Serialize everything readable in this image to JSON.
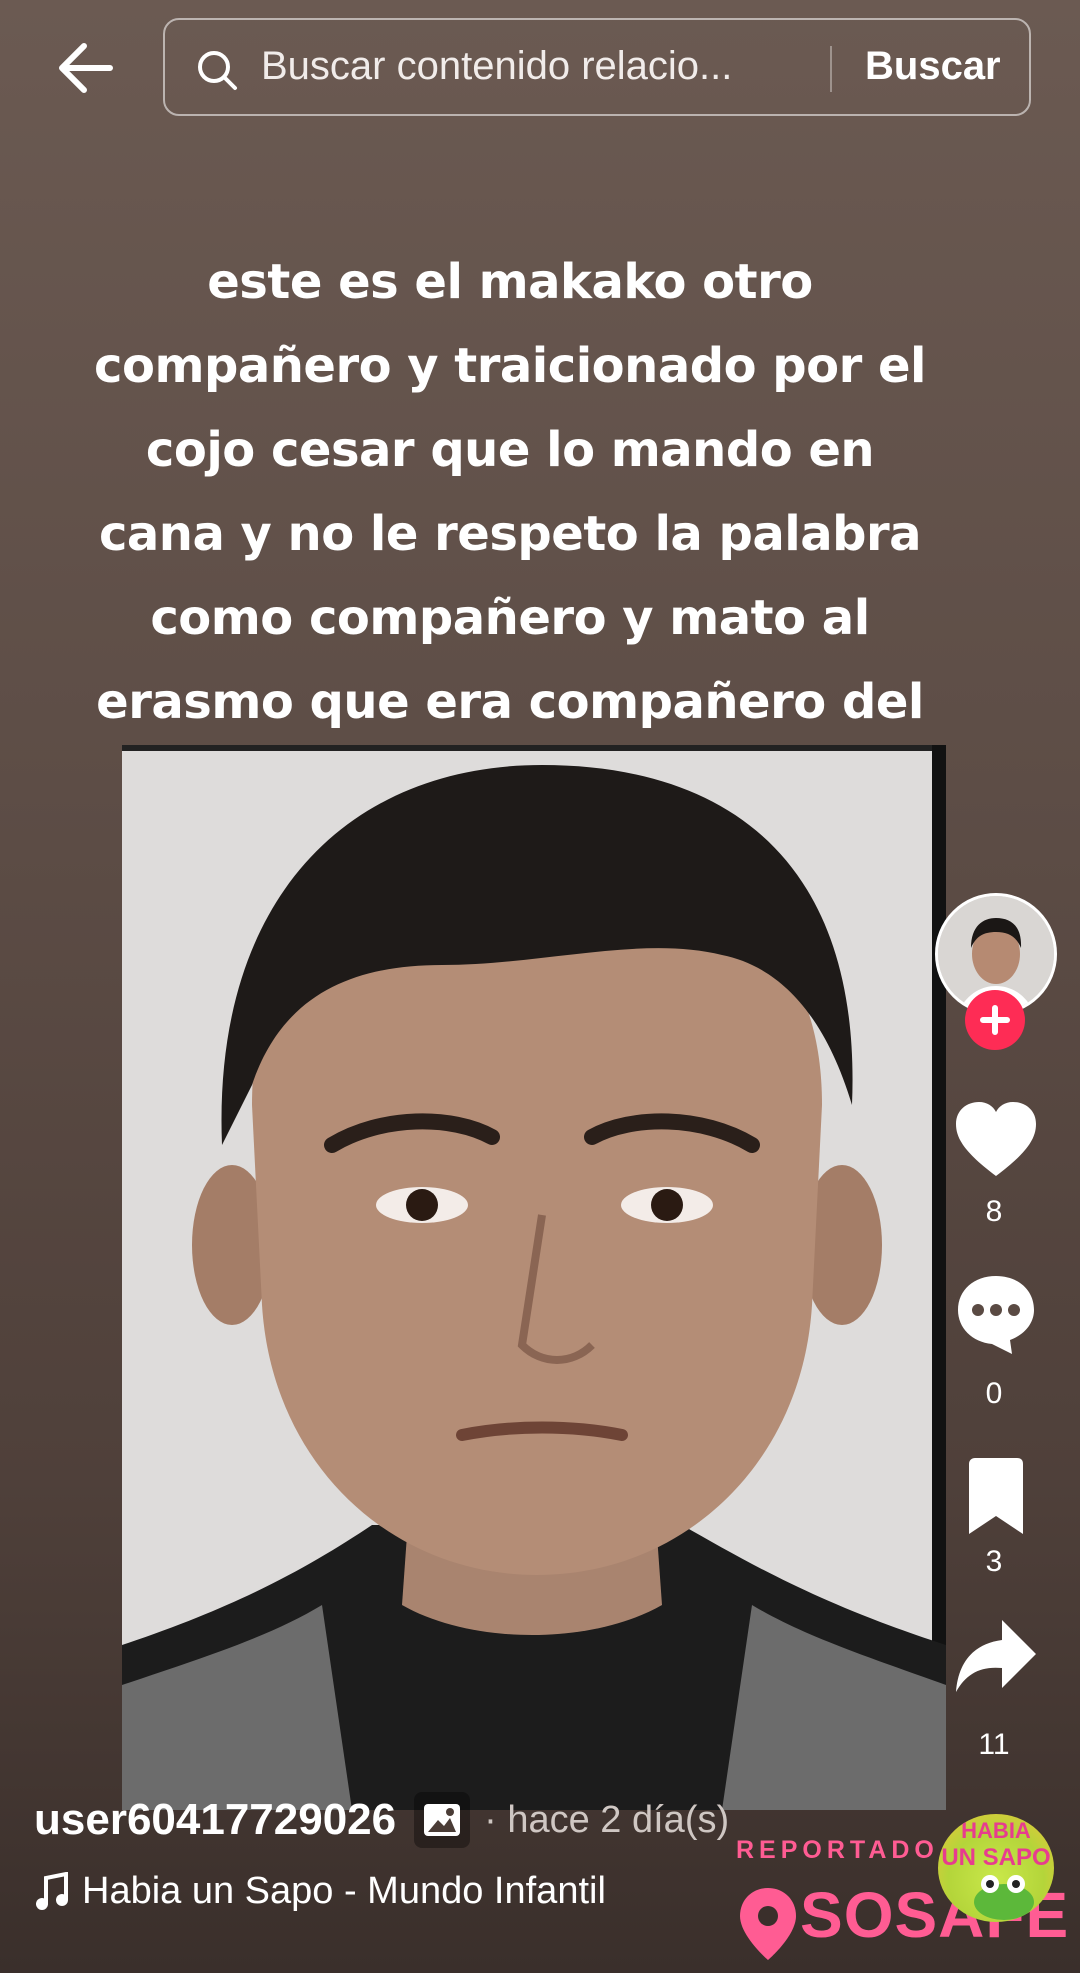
{
  "search": {
    "query": "Buscar contenido relacio...",
    "button_label": "Buscar"
  },
  "caption_lines": [
    "este es el makako otro",
    "compañero y traicionado por el",
    "cojo cesar que lo mando en",
    "cana y no le respeto la palabra",
    "como compañero y mato al",
    "erasmo que era compañero del"
  ],
  "actions": {
    "likes": "8",
    "comments": "0",
    "saves": "3",
    "shares": "11"
  },
  "post": {
    "username": "user60417729026",
    "time": "· hace 2 día(s)",
    "sound": "Habia un Sapo - Mundo Infantil"
  },
  "watermark": {
    "reported_label": "REPORTADO EN",
    "brand": "SOSAFE",
    "logo_line1": "HABIA",
    "logo_line2": "UN SAPO"
  },
  "colors": {
    "accent_red": "#fe2c55",
    "watermark_pink": "#ff5c93"
  },
  "icons": [
    "back-arrow-icon",
    "search-icon",
    "plus-icon",
    "heart-icon",
    "comment-icon",
    "bookmark-icon",
    "share-icon",
    "photo-icon",
    "music-note-icon",
    "location-pin-icon"
  ]
}
